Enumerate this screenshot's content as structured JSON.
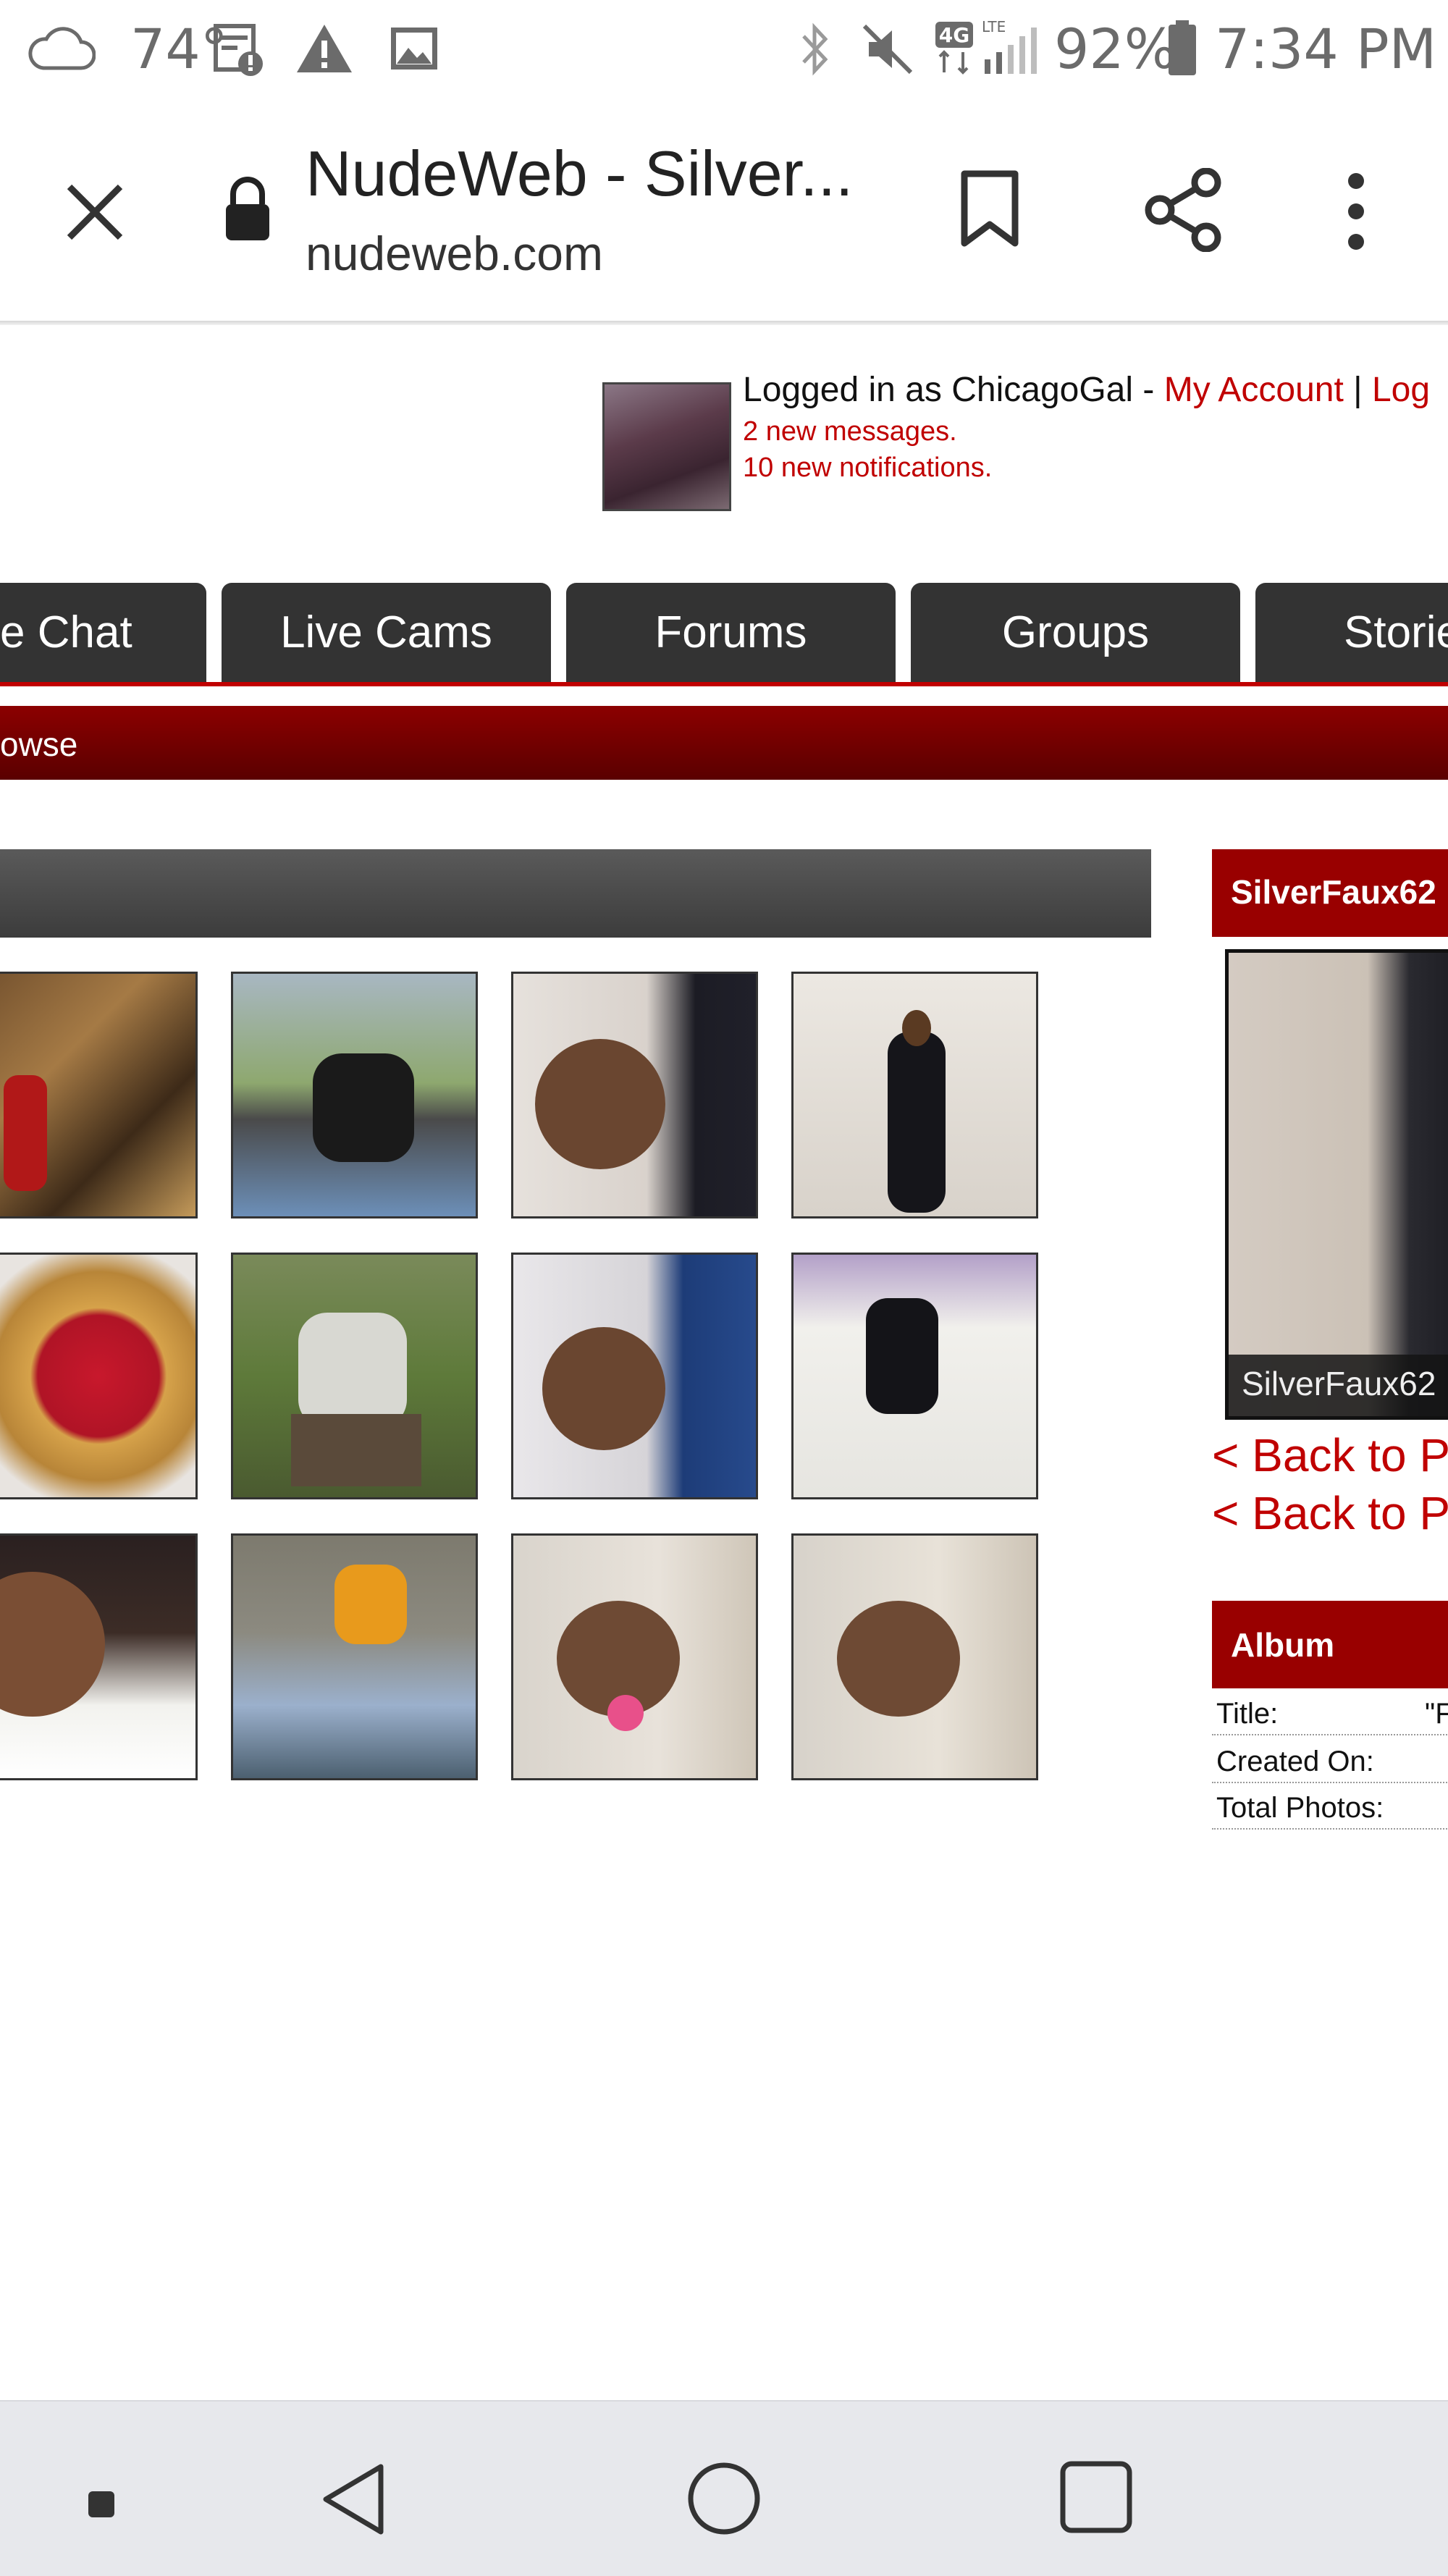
{
  "status_bar": {
    "temperature": "74°",
    "battery": "92%",
    "time": "7:34 PM",
    "network": "4G",
    "lte": "LTE"
  },
  "toolbar": {
    "page_title": "NudeWeb - Silver...",
    "url": "nudeweb.com"
  },
  "account": {
    "logged_in_prefix": "Logged in as ChicagoGal - ",
    "my_account": "My Account",
    "separator": " | ",
    "logout": "Log",
    "messages": "2 new messages.",
    "notifications": "10 new notifications."
  },
  "nav": {
    "tabs": [
      "e Chat",
      "Live Cams",
      "Forums",
      "Groups",
      "Storie"
    ]
  },
  "subnav": {
    "browse": "owse"
  },
  "sidebar": {
    "profile_name_header": "SilverFaux62",
    "profile_caption": "SilverFaux62",
    "back_link_1": "< Back to P",
    "back_link_2": "< Back to P",
    "album_header": "Album",
    "title_label": "Title:",
    "title_value": "\"F",
    "created_label": "Created On:",
    "total_label": "Total Photos:"
  },
  "colors": {
    "brand_red": "#c00000",
    "dark_red": "#7a0000",
    "nav_dark": "#333333"
  }
}
